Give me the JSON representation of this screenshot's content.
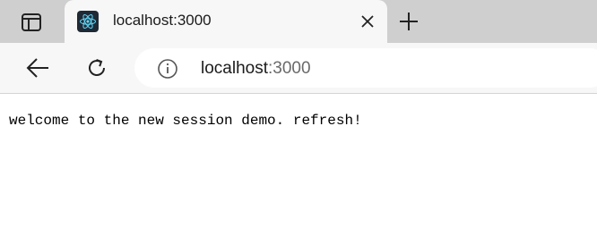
{
  "tab": {
    "title": "localhost:3000",
    "favicon": "react-logo-icon"
  },
  "toolbar": {
    "back_icon": "back-arrow-icon",
    "refresh_icon": "refresh-icon",
    "site_info_icon": "info-icon"
  },
  "address_bar": {
    "host": "localhost",
    "port": ":3000"
  },
  "page": {
    "text": "welcome to the new session demo. refresh!"
  },
  "colors": {
    "tabstrip": "#cfcfcf",
    "active_tab": "#f7f7f7",
    "favicon_bg": "#1f2a36",
    "react_blue": "#61dafb"
  }
}
